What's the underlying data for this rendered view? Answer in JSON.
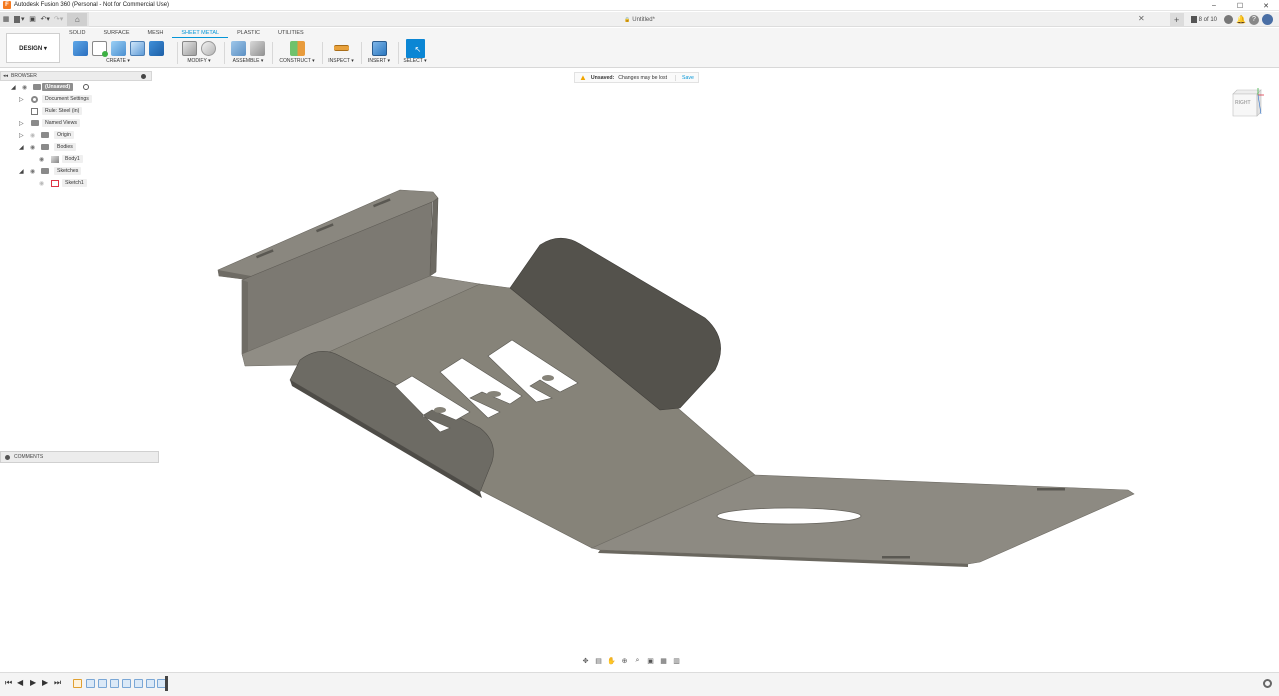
{
  "window": {
    "title": "Autodesk Fusion 360 (Personal - Not for Commercial Use)",
    "app_logo_letter": "F",
    "minimize": "–",
    "maximize": "☐",
    "close": "✕"
  },
  "qat": {
    "grid": "▦",
    "file": "▾",
    "save": "▣",
    "undo": "↶▾",
    "redo": "↷▾",
    "home": "⌂",
    "document_title": "Untitled*",
    "lock": "🔒",
    "doc_close": "✕",
    "new_tab": "+",
    "job_status": "8 of 10"
  },
  "toolbar": {
    "workspace": "DESIGN ▾",
    "tabs": [
      "SOLID",
      "SURFACE",
      "MESH",
      "SHEET METAL",
      "PLASTIC",
      "UTILITIES"
    ],
    "active_tab": "SHEET METAL",
    "groups": {
      "create": "CREATE ▾",
      "modify": "MODIFY ▾",
      "assemble": "ASSEMBLE ▾",
      "construct": "CONSTRUCT ▾",
      "inspect": "INSPECT ▾",
      "insert": "INSERT ▾",
      "select": "SELECT ▾"
    }
  },
  "browser": {
    "header": "BROWSER",
    "collapse": "◂◂",
    "items": [
      {
        "label": "(Unsaved)"
      },
      {
        "label": "Document Settings"
      },
      {
        "label": "Rule: Steel (in)"
      },
      {
        "label": "Named Views"
      },
      {
        "label": "Origin"
      },
      {
        "label": "Bodies"
      },
      {
        "label": "Body1"
      },
      {
        "label": "Sketches"
      },
      {
        "label": "Sketch1"
      }
    ]
  },
  "notice": {
    "status": "Unsaved:",
    "message": "Changes may be lost",
    "action": "Save"
  },
  "comments": {
    "header": "COMMENTS"
  },
  "viewcube": {
    "face": "RIGHT"
  },
  "colors": {
    "accent": "#0696d7",
    "metal_top": "#8a877f",
    "metal_dark": "#5a5852",
    "metal_edge": "#c9c6bf"
  }
}
